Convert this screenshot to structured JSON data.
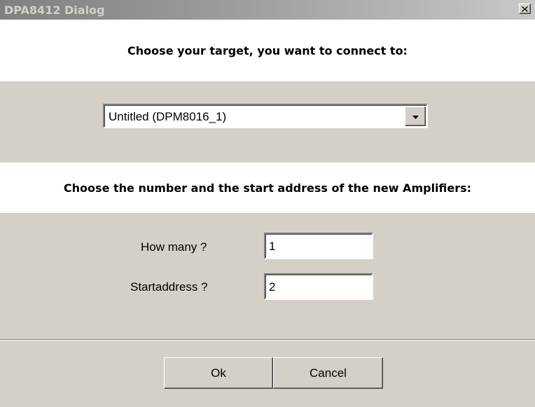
{
  "window": {
    "title": "DPA8412 Dialog",
    "close_icon": "close-icon"
  },
  "target_section": {
    "heading": "Choose your target, you want to connect to:",
    "selected_target": "Untitled (DPM8016_1)",
    "dropdown_icon": "chevron-down-icon"
  },
  "amplifier_section": {
    "heading": "Choose the number and the start address of the new Amplifiers:",
    "how_many_label": "How many ?",
    "how_many_value": "1",
    "start_address_label": "Startaddress ?",
    "start_address_value": "2"
  },
  "buttons": {
    "ok_label": "Ok",
    "cancel_label": "Cancel"
  }
}
